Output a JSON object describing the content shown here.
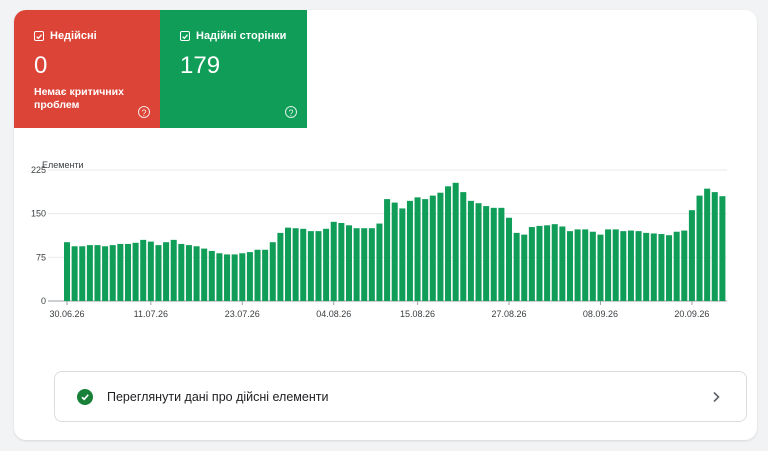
{
  "tiles": {
    "invalid": {
      "label": "Недійсні",
      "count": "0",
      "note": "Немає критичних проблем",
      "help": "?",
      "color": "#db4437"
    },
    "valid": {
      "label": "Надійні сторінки",
      "count": "179",
      "help": "?",
      "color": "#0f9d58"
    }
  },
  "chart_data": {
    "type": "bar",
    "ylabel": "Елементи",
    "yticks": [
      0,
      75,
      150,
      225
    ],
    "ylim": [
      0,
      225
    ],
    "xtick_labels": [
      "30.06.26",
      "11.07.26",
      "23.07.26",
      "04.08.26",
      "15.08.26",
      "27.08.26",
      "08.09.26",
      "20.09.26"
    ],
    "xtick_indices": [
      0,
      11,
      23,
      35,
      46,
      58,
      70,
      82
    ],
    "grid": true,
    "color": "#0f9d58",
    "values": [
      101,
      94,
      94,
      96,
      96,
      94,
      96,
      98,
      98,
      100,
      105,
      102,
      96,
      101,
      105,
      98,
      96,
      94,
      90,
      86,
      82,
      80,
      80,
      82,
      84,
      88,
      88,
      101,
      117,
      126,
      125,
      124,
      120,
      120,
      124,
      136,
      134,
      130,
      125,
      125,
      125,
      133,
      175,
      169,
      159,
      172,
      178,
      175,
      181,
      186,
      197,
      203,
      187,
      172,
      168,
      163,
      160,
      160,
      143,
      117,
      114,
      127,
      129,
      130,
      132,
      128,
      120,
      123,
      123,
      119,
      114,
      123,
      123,
      120,
      121,
      120,
      117,
      116,
      115,
      113,
      119,
      121,
      156,
      181,
      193,
      187,
      180
    ]
  },
  "valid_items_link": {
    "label": "Переглянути дані про дійсні елементи"
  }
}
